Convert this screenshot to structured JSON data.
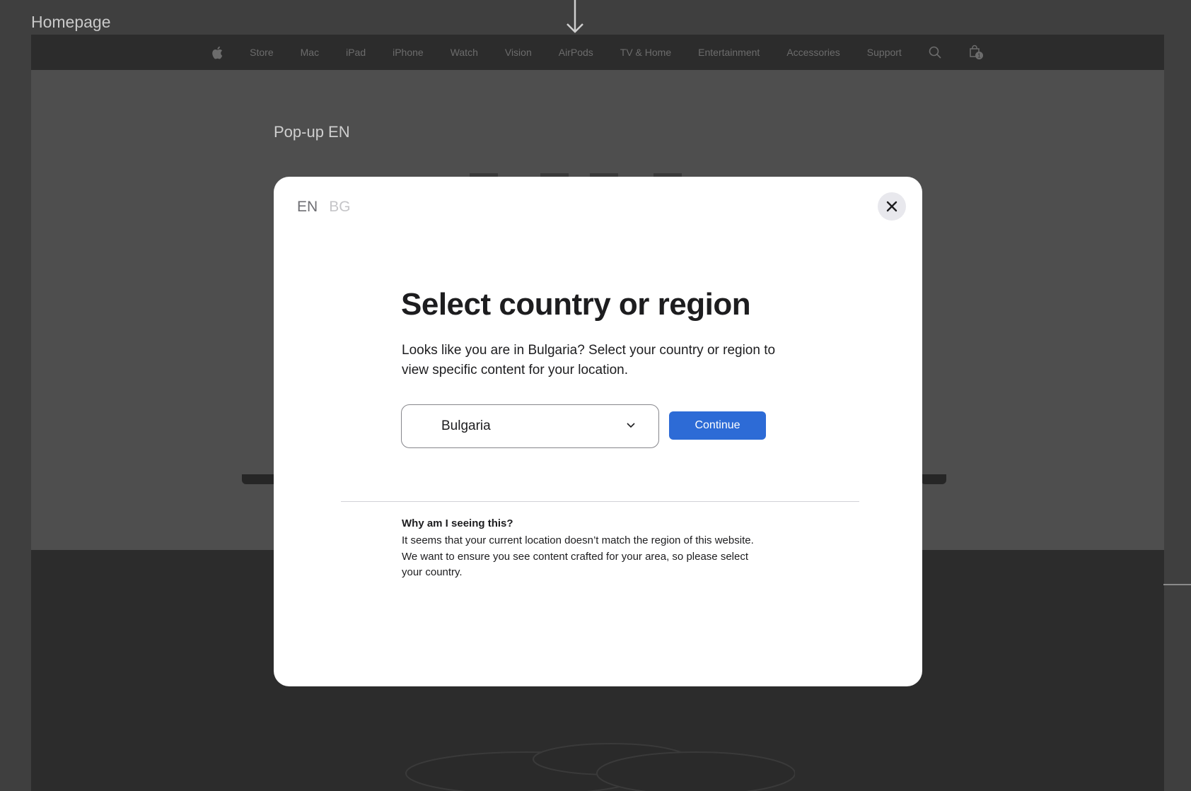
{
  "frame": {
    "label": "Homepage"
  },
  "nav": {
    "items": [
      "Store",
      "Mac",
      "iPad",
      "iPhone",
      "Watch",
      "Vision",
      "AirPods",
      "TV & Home",
      "Entertainment",
      "Accessories",
      "Support"
    ],
    "icons": [
      "apple-logo",
      "search-icon",
      "bag-icon"
    ],
    "bag_count": "1"
  },
  "page": {
    "popup_label": "Pop-up EN"
  },
  "modal": {
    "lang_en": "EN",
    "lang_bg": "BG",
    "title": "Select country or region",
    "description": "Looks like you are in Bulgaria? Select your country or region to view specific content for your location.",
    "select": {
      "value": "Bulgaria"
    },
    "continue_label": "Continue",
    "why_title": "Why am I seeing this?",
    "why_body": "It seems that your current location doesn’t match the region of this website. We want to ensure you see content crafted for your area, so please select your country."
  },
  "colors": {
    "accent": "#2d6bd6",
    "overlay": "#4e4e4e",
    "nav": "#2c2c2c"
  }
}
